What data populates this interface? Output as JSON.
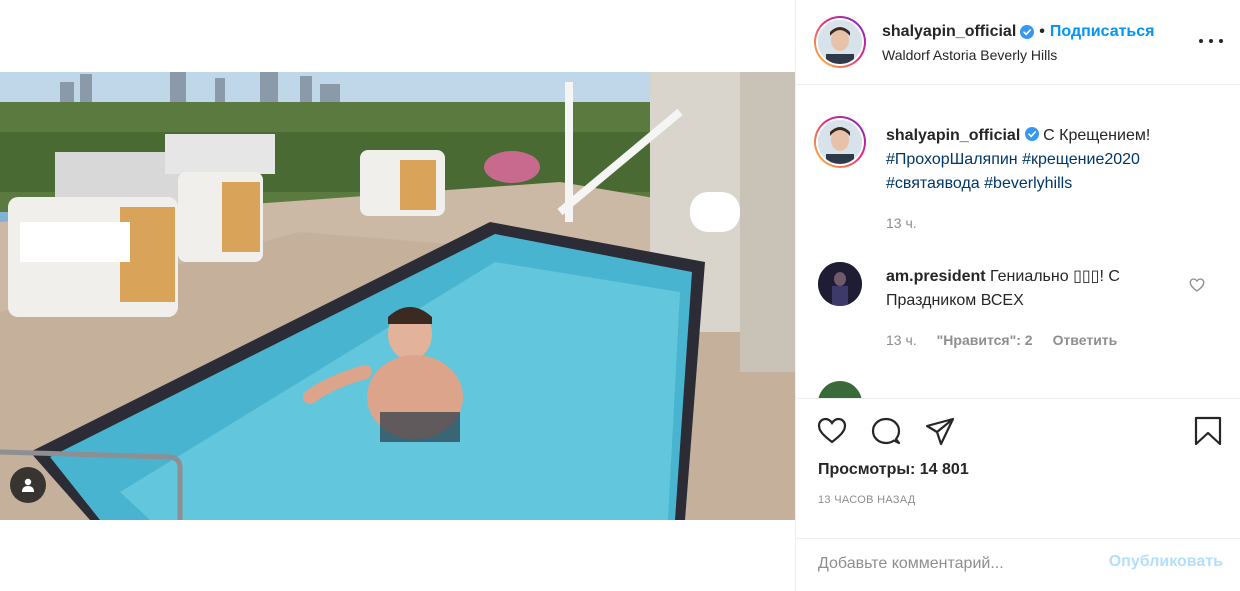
{
  "header": {
    "username": "shalyapin_official",
    "separator": "•",
    "follow_label": "Подписаться",
    "location": "Waldorf Astoria Beverly Hills"
  },
  "caption": {
    "username": "shalyapin_official",
    "text": "С Крещением!",
    "hashtags": [
      "#ПрохорШаляпин",
      "#крещение2020",
      "#святаявода",
      "#beverlyhills"
    ],
    "time": "13 ч."
  },
  "comments": [
    {
      "username": "am.president",
      "text": "Гениально ▯▯▯! С Праздником ВСЕХ",
      "time": "13 ч.",
      "likes_label": "\"Нравится\": 2",
      "reply_label": "Ответить"
    },
    {
      "username": "",
      "text": ""
    }
  ],
  "stats": {
    "views": "Просмотры: 14 801",
    "posted_ago": "13 ЧАСОВ НАЗАД"
  },
  "composer": {
    "placeholder": "Добавьте комментарий...",
    "post_label": "Опубликовать"
  },
  "colors": {
    "link": "#0095f6",
    "hashtag": "#00376b",
    "muted": "#8e8e8e",
    "text": "#262626",
    "post_disabled": "#b2dffc"
  },
  "icons": {
    "verified": "verified-badge-icon",
    "more": "more-options-icon",
    "like": "heart-icon",
    "comment": "comment-bubble-icon",
    "share": "paper-plane-icon",
    "save": "bookmark-icon",
    "tag": "user-tag-icon"
  }
}
